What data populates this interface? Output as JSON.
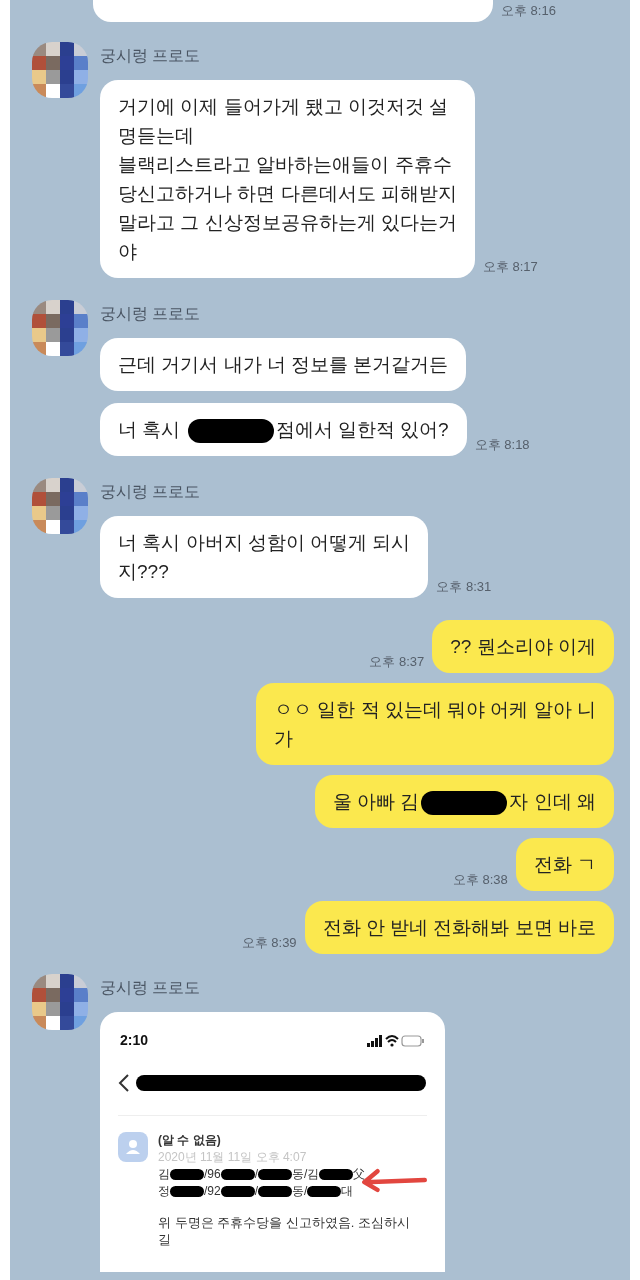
{
  "messages": [
    {
      "kind": "cut",
      "time": "오후 8:16"
    },
    {
      "kind": "received",
      "name": "궁시렁 프로도",
      "bubbles": [
        {
          "parts": [
            {
              "kind": "text",
              "text": "거기에 이제 들어가게 됐고 이것저것 설\n명듣는데\n블랙리스트라고 알바하는애들이 주휴수\n당신고하거나 하면 다른데서도 피해받지\n말라고 그 신상정보공유하는게 있다는거\n야"
            }
          ],
          "time": "오후 8:17"
        }
      ]
    },
    {
      "kind": "received",
      "name": "궁시렁 프로도",
      "bubbles": [
        {
          "parts": [
            {
              "kind": "text",
              "text": "근데 거기서 내가 너 정보를 본거같거든"
            }
          ]
        },
        {
          "parts": [
            {
              "kind": "text",
              "text": "너 혹시 "
            },
            {
              "kind": "redaction"
            },
            {
              "kind": "text",
              "text": "점에서 일한적 있어?"
            }
          ],
          "time": "오후 8:18"
        }
      ]
    },
    {
      "kind": "received",
      "name": "궁시렁 프로도",
      "bubbles": [
        {
          "parts": [
            {
              "kind": "text",
              "text": "너 혹시 아버지 성함이 어떻게 되시\n지???"
            }
          ],
          "time": "오후 8:31"
        }
      ]
    },
    {
      "kind": "sent",
      "bubbles": [
        {
          "parts": [
            {
              "kind": "text",
              "text": "?? 뭔소리야 이게"
            }
          ],
          "time": "오후 8:37"
        },
        {
          "parts": [
            {
              "kind": "text",
              "text": "ㅇㅇ 일한 적 있는데 뭐야 어케 알아 니\n가"
            }
          ]
        },
        {
          "parts": [
            {
              "kind": "text",
              "text": "울 아빠 김"
            },
            {
              "kind": "redaction"
            },
            {
              "kind": "text",
              "text": "자 인데 왜"
            }
          ]
        },
        {
          "parts": [
            {
              "kind": "text",
              "text": "전화 ㄱ"
            }
          ],
          "time": "오후 8:38"
        },
        {
          "parts": [
            {
              "kind": "text",
              "text": "전화 안 받네 전화해봐 보면 바로"
            }
          ],
          "time": "오후 8:39"
        }
      ]
    },
    {
      "name": "궁시렁 프로도",
      "shot": {
        "clock": "2:10",
        "author": "(알 수 없음)",
        "date": "2020년 11월 11일 오후 4:07",
        "lines": [
          [
            {
              "kind": "text",
              "text": "김"
            },
            {
              "kind": "redaction"
            },
            {
              "kind": "text",
              "text": "/96"
            },
            {
              "kind": "redaction"
            },
            {
              "kind": "text",
              "text": "/"
            },
            {
              "kind": "redaction"
            },
            {
              "kind": "text",
              "text": "동/김"
            },
            {
              "kind": "redaction"
            },
            {
              "kind": "text",
              "text": "父"
            }
          ],
          [
            {
              "kind": "text",
              "text": "정"
            },
            {
              "kind": "redaction"
            },
            {
              "kind": "text",
              "text": "/92"
            },
            {
              "kind": "redaction"
            },
            {
              "kind": "text",
              "text": "/"
            },
            {
              "kind": "redaction"
            },
            {
              "kind": "text",
              "text": "동/"
            },
            {
              "kind": "redaction"
            },
            {
              "kind": "text",
              "text": "대"
            }
          ]
        ],
        "note": "위 두명은 주휴수당을 신고하였음. 조심하시\n길"
      }
    }
  ]
}
